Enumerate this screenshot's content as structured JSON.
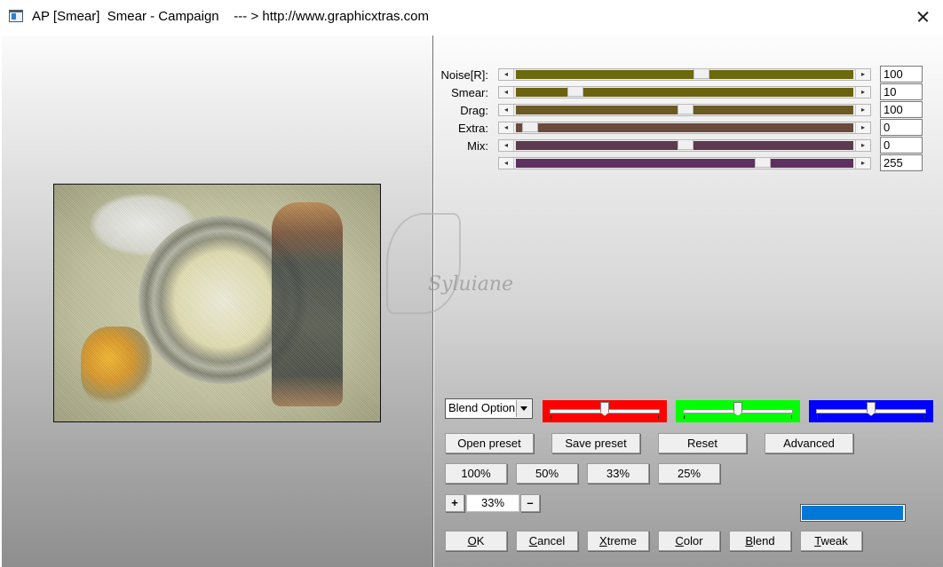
{
  "window": {
    "title": "AP [Smear]  Smear - Campaign    --- > http://www.graphicxtras.com"
  },
  "preview": {
    "watermark_text": "Syluiane"
  },
  "sliders": [
    {
      "label": "Noise[R]:",
      "value": "100",
      "position": 0.55,
      "color": "#6b6a0c"
    },
    {
      "label": "Smear:",
      "value": "10",
      "position": 0.16,
      "color": "#6b6210"
    },
    {
      "label": "Drag:",
      "value": "100",
      "position": 0.5,
      "color": "#6b5a24"
    },
    {
      "label": "Extra:",
      "value": "0",
      "position": 0.02,
      "color": "#6a4a3c"
    },
    {
      "label": "Mix:",
      "value": "0",
      "position": 0.5,
      "color": "#5e3a4e"
    },
    {
      "label": "",
      "value": "255",
      "position": 0.74,
      "color": "#5e3060"
    }
  ],
  "blend": {
    "selected": "Blend Option",
    "red": {
      "color": "#ff0000",
      "position": 0.5
    },
    "green": {
      "color": "#00ff00",
      "position": 0.5
    },
    "blue": {
      "color": "#0000ff",
      "position": 0.5
    }
  },
  "preset_buttons": {
    "open": "Open preset",
    "save": "Save preset",
    "reset": "Reset",
    "advanced": "Advanced"
  },
  "zoom_buttons": [
    "100%",
    "50%",
    "33%",
    "25%"
  ],
  "zoom": {
    "plus": "+",
    "value": "33%",
    "minus": "–"
  },
  "progress": {
    "fraction": 0.99,
    "color": "#0078d7"
  },
  "action_buttons": {
    "ok": {
      "accel": "O",
      "rest": "K"
    },
    "cancel": {
      "accel": "C",
      "rest": "ancel"
    },
    "xtreme": {
      "accel": "X",
      "rest": "treme"
    },
    "color": {
      "accel": "C",
      "rest": "olor"
    },
    "blend": {
      "accel": "B",
      "rest": "lend"
    },
    "tweak": {
      "accel": "T",
      "rest": "weak"
    }
  }
}
